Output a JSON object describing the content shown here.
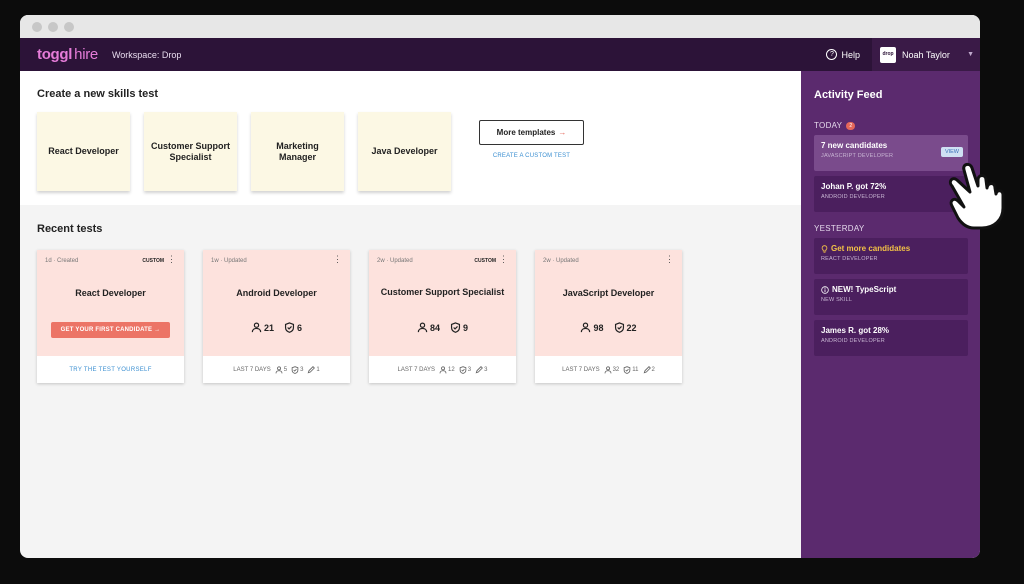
{
  "header": {
    "logo_brand": "toggl",
    "logo_product": "hire",
    "workspace": "Workspace: Drop",
    "help_label": "Help",
    "user_avatar_text": "drop",
    "user_name": "Noah Taylor"
  },
  "create": {
    "title": "Create a new skills test",
    "templates": [
      {
        "label": "React Developer"
      },
      {
        "label": "Customer Support Specialist"
      },
      {
        "label": "Marketing Manager"
      },
      {
        "label": "Java Developer"
      }
    ],
    "more_templates": "More templates",
    "more_arrow": "→",
    "custom_test_link": "CREATE A CUSTOM TEST"
  },
  "recent": {
    "title": "Recent tests",
    "cards": [
      {
        "meta": "1d · Created",
        "badge": "CUSTOM",
        "title": "React Developer",
        "cta": "GET YOUR FIRST CANDIDATE →",
        "footer_link": "TRY THE TEST YOURSELF"
      },
      {
        "meta": "1w · Updated",
        "title": "Android Developer",
        "candidates": "21",
        "passed": "6",
        "last7_label": "LAST 7 DAYS",
        "last7_candidates": "5",
        "last7_passed": "3",
        "last7_reviews": "1"
      },
      {
        "meta": "2w · Updated",
        "badge": "CUSTOM",
        "title": "Customer Support Specialist",
        "candidates": "84",
        "passed": "9",
        "last7_label": "LAST 7 DAYS",
        "last7_candidates": "12",
        "last7_passed": "3",
        "last7_reviews": "3"
      },
      {
        "meta": "2w · Updated",
        "title": "JavaScript Developer",
        "candidates": "98",
        "passed": "22",
        "last7_label": "LAST 7 DAYS",
        "last7_candidates": "32",
        "last7_passed": "11",
        "last7_reviews": "2"
      }
    ]
  },
  "feed": {
    "title": "Activity Feed",
    "today_label": "TODAY",
    "today_count": "2",
    "today_items": [
      {
        "title": "7 new candidates",
        "sub": "JAVASCRIPT DEVELOPER",
        "action": "VIEW"
      },
      {
        "title": "Johan P. got 72%",
        "sub": "ANDROID DEVELOPER"
      }
    ],
    "yesterday_label": "YESTERDAY",
    "yesterday_items": [
      {
        "title": "Get more candidates",
        "sub": "REACT DEVELOPER",
        "icon": "lightbulb-icon"
      },
      {
        "title": "NEW! TypeScript",
        "sub": "NEW SKILL",
        "icon": "info-icon"
      },
      {
        "title": "James R. got 28%",
        "sub": "ANDROID DEVELOPER"
      }
    ]
  },
  "colors": {
    "header_bg": "#2c1338",
    "sidebar_bg": "#5b2a6e",
    "brand_pink": "#e57cd8",
    "accent_coral": "#ec7466",
    "template_bg": "#fcf8e4",
    "test_card_bg": "#fde2dd",
    "link_blue": "#3b8fd1"
  }
}
